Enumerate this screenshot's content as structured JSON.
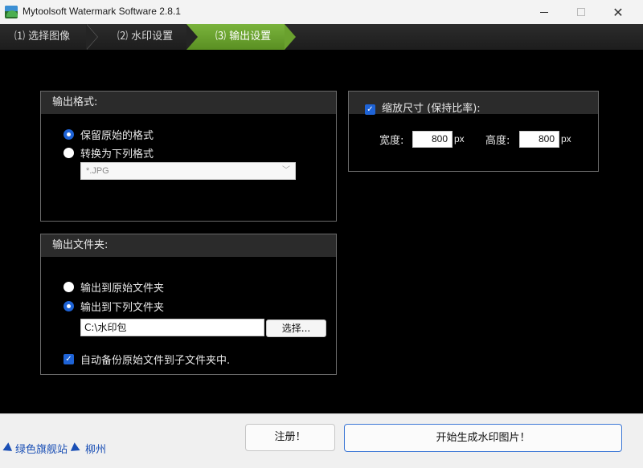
{
  "window": {
    "title": "Mytoolsoft Watermark Software 2.8.1",
    "minimize_glyph": "",
    "close_glyph": "✕"
  },
  "steps": [
    {
      "label": "⑴ 选择图像"
    },
    {
      "label": "⑵ 水印设置"
    },
    {
      "label": "⑶ 输出设置"
    }
  ],
  "output_format": {
    "header": "输出格式:",
    "options": [
      {
        "label": "保留原始的格式",
        "selected": true
      },
      {
        "label": "转换为下列格式",
        "selected": false
      }
    ],
    "format_select": {
      "value": "*.JPG",
      "chevron": "﹀"
    }
  },
  "output_folder": {
    "header": "输出文件夹:",
    "options": [
      {
        "label": "输出到原始文件夹",
        "selected": false
      },
      {
        "label": "输出到下列文件夹",
        "selected": true
      }
    ],
    "path_value": "C:\\水印包",
    "browse_label": "选择...",
    "backup_label": "自动备份原始文件到子文件夹中.",
    "backup_checked": true
  },
  "scale": {
    "header": "缩放尺寸 (保持比率):",
    "checked": true,
    "width_label": "宽度:",
    "width_value": "800",
    "height_label": "高度:",
    "height_value": "800",
    "unit": "px"
  },
  "footer": {
    "site_text": "绿色旗舰站",
    "city_text": "柳州",
    "register_label": "注册！",
    "start_label": "开始生成水印图片！"
  },
  "colors": {
    "accent_green": "#6aa12e",
    "accent_blue": "#1e63d6",
    "link_blue": "#1a4fb5"
  }
}
